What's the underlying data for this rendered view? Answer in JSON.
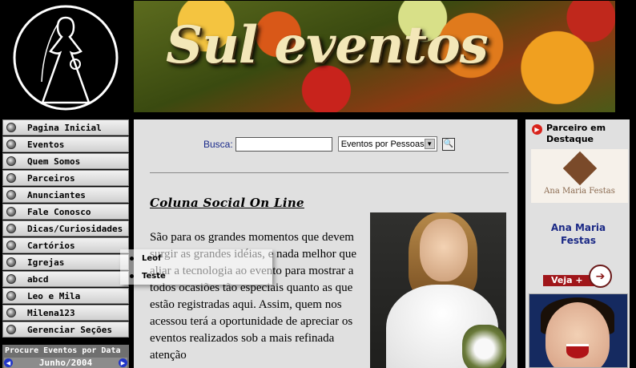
{
  "header": {
    "banner_title": "Sul eventos"
  },
  "menu": {
    "items": [
      {
        "label": "Pagina Inicial"
      },
      {
        "label": "Eventos"
      },
      {
        "label": "Quem Somos"
      },
      {
        "label": "Parceiros"
      },
      {
        "label": "Anunciantes"
      },
      {
        "label": "Fale Conosco"
      },
      {
        "label": "Dicas/Curiosidades"
      },
      {
        "label": "Cartórios"
      },
      {
        "label": "Igrejas"
      },
      {
        "label": "abcd"
      },
      {
        "label": "Leo e Mila"
      },
      {
        "label": "Milena123"
      },
      {
        "label": "Gerenciar Seções"
      }
    ],
    "submenu": [
      {
        "label": "Leof"
      },
      {
        "label": "Teste"
      }
    ]
  },
  "calendar": {
    "title": "Procure Eventos por Data",
    "month": "Junho/2004",
    "prev": "◀",
    "next": "▶"
  },
  "search": {
    "label": "Busca:",
    "input_value": "",
    "select_value": "Eventos por Pessoas"
  },
  "article": {
    "title": "Coluna Social On Line",
    "body": "São para os grandes momentos que devem surgir as grandes idéias, e nada melhor que aliar a tecnologia ao evento para mostrar a todos ocasiões tão especiais quanto as que estão registradas aqui. Assim, quem nos acessou terá a oportunidade de apreciar os eventos realizados sob a mais refinada atenção"
  },
  "partner": {
    "heading": "Parceiro em Destaque",
    "logo_text": "Ana Maria Festas",
    "name": "Ana Maria Festas",
    "button_label": "Veja +"
  }
}
